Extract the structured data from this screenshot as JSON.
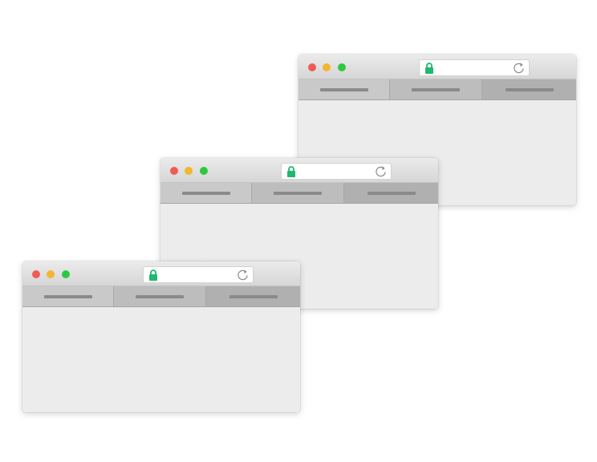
{
  "colors": {
    "close": "#f25a55",
    "minimize": "#f2b62f",
    "maximize": "#2ec840",
    "lock": "#1fb86e",
    "reload": "#8a8a8a"
  },
  "icons": {
    "lock": "lock-icon",
    "reload": "reload-icon"
  },
  "windows": [
    {
      "label": "back-window",
      "tabs": [
        "",
        "",
        ""
      ],
      "address": ""
    },
    {
      "label": "middle-window",
      "tabs": [
        "",
        "",
        ""
      ],
      "address": ""
    },
    {
      "label": "front-window",
      "tabs": [
        "",
        "",
        ""
      ],
      "address": ""
    }
  ]
}
